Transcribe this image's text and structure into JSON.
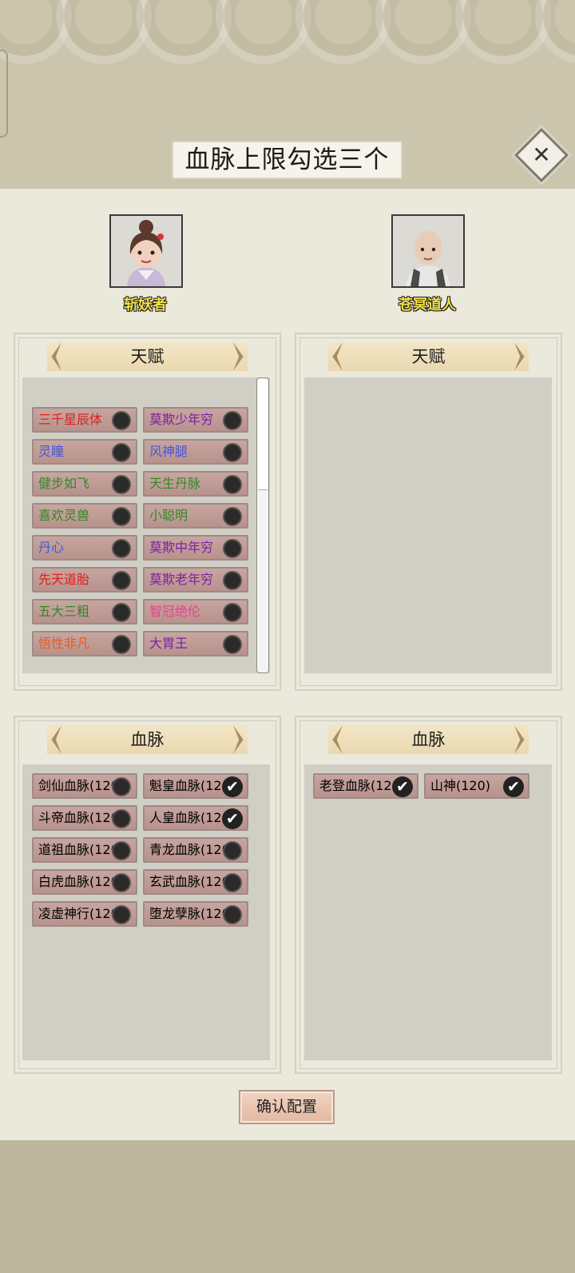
{
  "title": "血脉上限勾选三个",
  "close_icon": "close-icon",
  "characters": [
    {
      "name": "斩妖者"
    },
    {
      "name": "苍冥道人"
    }
  ],
  "talent_header": "天赋",
  "bloodline_header": "血脉",
  "left_talents": [
    {
      "label": "三千星辰体",
      "color": "#e0201b"
    },
    {
      "label": "莫欺少年穷",
      "color": "#7a1fa8"
    },
    {
      "label": "灵瞳",
      "color": "#4556d8"
    },
    {
      "label": "风神腿",
      "color": "#4556d8"
    },
    {
      "label": "健步如飞",
      "color": "#2e8a24"
    },
    {
      "label": "天生丹脉",
      "color": "#2e8a24"
    },
    {
      "label": "喜欢灵兽",
      "color": "#2e8a24"
    },
    {
      "label": "小聪明",
      "color": "#2e8a24"
    },
    {
      "label": "丹心",
      "color": "#4556d8"
    },
    {
      "label": "莫欺中年穷",
      "color": "#7a1fa8"
    },
    {
      "label": "先天道胎",
      "color": "#e0201b"
    },
    {
      "label": "莫欺老年穷",
      "color": "#7a1fa8"
    },
    {
      "label": "五大三粗",
      "color": "#2e8a24"
    },
    {
      "label": "智冠绝伦",
      "color": "#e3458e"
    },
    {
      "label": "悟性非凡",
      "color": "#e85a17"
    },
    {
      "label": "大胃王",
      "color": "#7a1fa8"
    }
  ],
  "left_bloodlines": [
    {
      "label": "剑仙血脉(120)",
      "checked": false
    },
    {
      "label": "魁皇血脉(120)",
      "checked": true
    },
    {
      "label": "斗帝血脉(120)",
      "checked": false
    },
    {
      "label": "人皇血脉(120)",
      "checked": true
    },
    {
      "label": "道祖血脉(120)",
      "checked": false
    },
    {
      "label": "青龙血脉(120)",
      "checked": false
    },
    {
      "label": "白虎血脉(120)",
      "checked": false
    },
    {
      "label": "玄武血脉(120)",
      "checked": false
    },
    {
      "label": "凌虚神行(120)",
      "checked": false
    },
    {
      "label": "堕龙孽脉(120)",
      "checked": false
    }
  ],
  "right_bloodlines": [
    {
      "label": "老登血脉(120)",
      "checked": true
    },
    {
      "label": "山神(120)",
      "checked": true
    }
  ],
  "check_glyph": "✔",
  "confirm_label": "确认配置"
}
